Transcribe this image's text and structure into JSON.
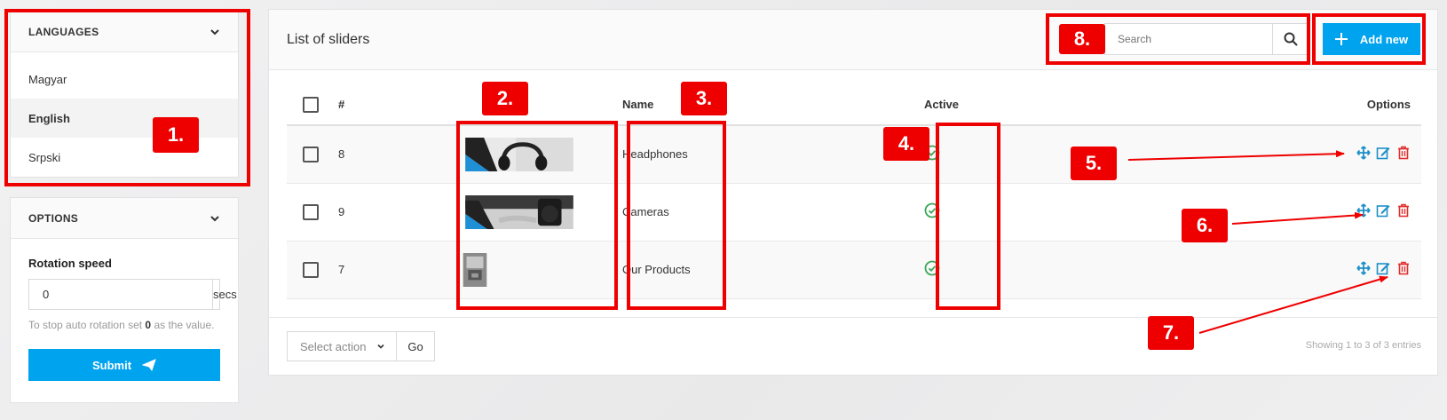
{
  "languages": {
    "header": "LANGUAGES",
    "items": [
      {
        "label": "Magyar"
      },
      {
        "label": "English"
      },
      {
        "label": "Srpski"
      }
    ]
  },
  "options": {
    "header": "OPTIONS",
    "rotation_label": "Rotation speed",
    "rotation_value": "0",
    "rotation_unit": "secs",
    "hint_prefix": "To stop auto rotation set ",
    "hint_bold": "0",
    "hint_suffix": " as the value.",
    "submit_label": "Submit"
  },
  "main": {
    "title": "List of sliders",
    "search_placeholder": "Search",
    "add_label": "Add new",
    "columns": {
      "num": "#",
      "name": "Name",
      "active": "Active",
      "options": "Options"
    },
    "rows": [
      {
        "num": "8",
        "name": "Headphones"
      },
      {
        "num": "9",
        "name": "Cameras"
      },
      {
        "num": "7",
        "name": "Our Products"
      }
    ],
    "select_action": "Select action",
    "go_label": "Go",
    "showing": "Showing 1 to 3 of 3 entries"
  },
  "annotations": [
    "1.",
    "2.",
    "3.",
    "4.",
    "5.",
    "6.",
    "7.",
    "8."
  ],
  "colors": {
    "accent": "#00a3ee",
    "active": "#3aa757",
    "move": "#1e90c8",
    "edit": "#1e90c8",
    "delete": "#e0302e",
    "annotation": "#ee0000"
  }
}
